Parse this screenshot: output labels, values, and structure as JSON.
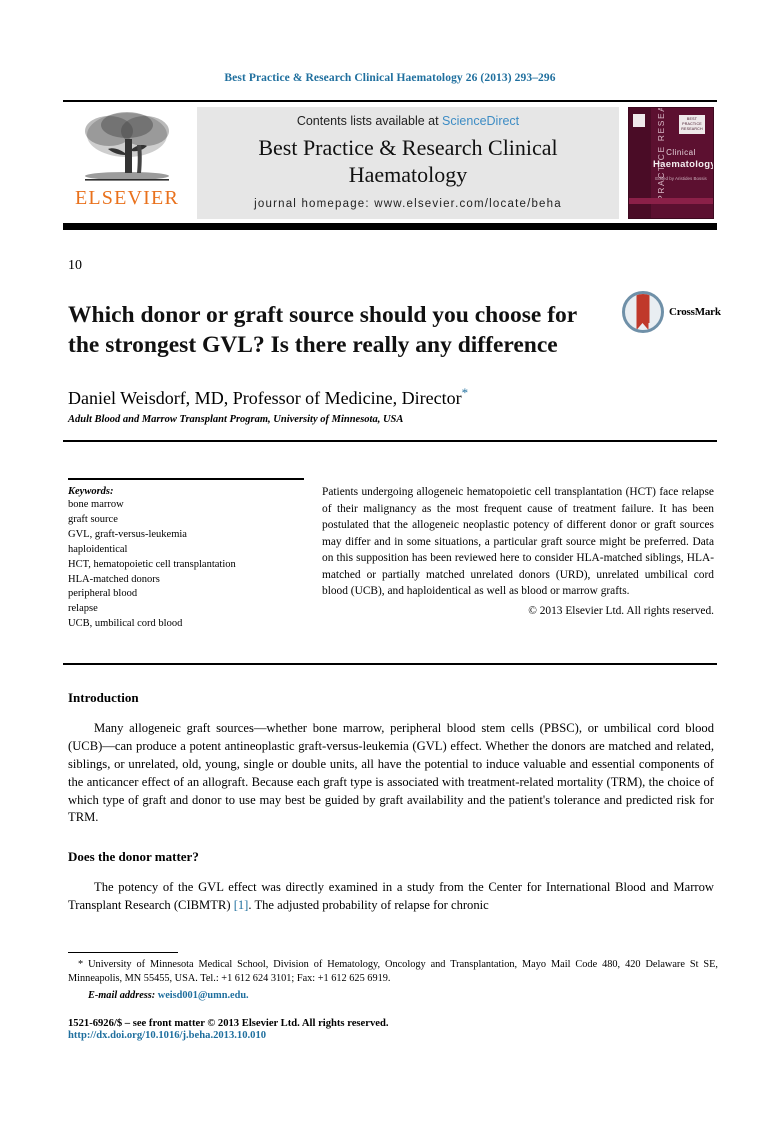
{
  "running_head": "Best Practice & Research Clinical Haematology 26 (2013) 293–296",
  "masthead": {
    "publisher_wordmark": "ELSEVIER",
    "contents_prefix": "Contents lists available at ",
    "contents_link": "ScienceDirect",
    "journal_title_line1": "Best Practice & Research Clinical",
    "journal_title_line2": "Haematology",
    "journal_homepage": "journal homepage: www.elsevier.com/locate/beha",
    "cover": {
      "spine_text": "PRACTICE RESEARCH",
      "badge_text": "BEST PRACTICE RESEARCH",
      "title_line1": "Clinical",
      "title_line2": "Haematology",
      "editor_text": "Edited by Aristides Bossis"
    }
  },
  "article": {
    "chapter_number": "10",
    "title": "Which donor or graft source should you choose for the strongest GVL? Is there really any difference",
    "crossmark_label": "CrossMark",
    "author": "Daniel Weisdorf, MD, Professor of Medicine, Director",
    "author_footnote_mark": "*",
    "affiliation": "Adult Blood and Marrow Transplant Program, University of Minnesota, USA"
  },
  "keywords": {
    "heading": "Keywords:",
    "items": [
      "bone marrow",
      "graft source",
      "GVL, graft-versus-leukemia",
      "haploidentical",
      "HCT, hematopoietic cell transplantation",
      "HLA-matched donors",
      "peripheral blood",
      "relapse",
      "UCB, umbilical cord blood"
    ]
  },
  "abstract": {
    "text": "Patients undergoing allogeneic hematopoietic cell transplantation (HCT) face relapse of their malignancy as the most frequent cause of treatment failure. It has been postulated that the allogeneic neoplastic potency of different donor or graft sources may differ and in some situations, a particular graft source might be preferred. Data on this supposition has been reviewed here to consider HLA-matched siblings, HLA-matched or partially matched unrelated donors (URD), unrelated umbilical cord blood (UCB), and haploidentical as well as blood or marrow grafts.",
    "copyright": "© 2013 Elsevier Ltd. All rights reserved."
  },
  "body": {
    "section1_heading": "Introduction",
    "section1_paragraph": "Many allogeneic graft sources—whether bone marrow, peripheral blood stem cells (PBSC), or umbilical cord blood (UCB)—can produce a potent antineoplastic graft-versus-leukemia (GVL) effect. Whether the donors are matched and related, siblings, or unrelated, old, young, single or double units, all have the potential to induce valuable and essential components of the anticancer effect of an allograft. Because each graft type is associated with treatment-related mortality (TRM), the choice of which type of graft and donor to use may best be guided by graft availability and the patient's tolerance and predicted risk for TRM.",
    "section2_heading": "Does the donor matter?",
    "section2_paragraph_part1": "The potency of the GVL effect was directly examined in a study from the Center for International Blood and Marrow Transplant Research (CIBMTR) ",
    "section2_reference": "[1]",
    "section2_paragraph_part2": ". The adjusted probability of relapse for chronic"
  },
  "footnotes": {
    "corresponding": "* University of Minnesota Medical School, Division of Hematology, Oncology and Transplantation, Mayo Mail Code 480, 420 Delaware St SE, Minneapolis, MN 55455, USA. Tel.: +1 612 624 3101; Fax: +1 612 625 6919.",
    "email_label": "E-mail address:",
    "email": "weisd001@umn.edu."
  },
  "imprint": {
    "issn_line": "1521-6926/$ – see front matter © 2013 Elsevier Ltd. All rights reserved.",
    "doi": "http://dx.doi.org/10.1016/j.beha.2013.10.010"
  },
  "colors": {
    "link_blue": "#1f6f9e",
    "sciencedirect_blue": "#3d8cc4",
    "elsevier_orange": "#E9711C",
    "cover_maroon": "#5c1030",
    "masthead_grey": "#e6e6e6"
  }
}
